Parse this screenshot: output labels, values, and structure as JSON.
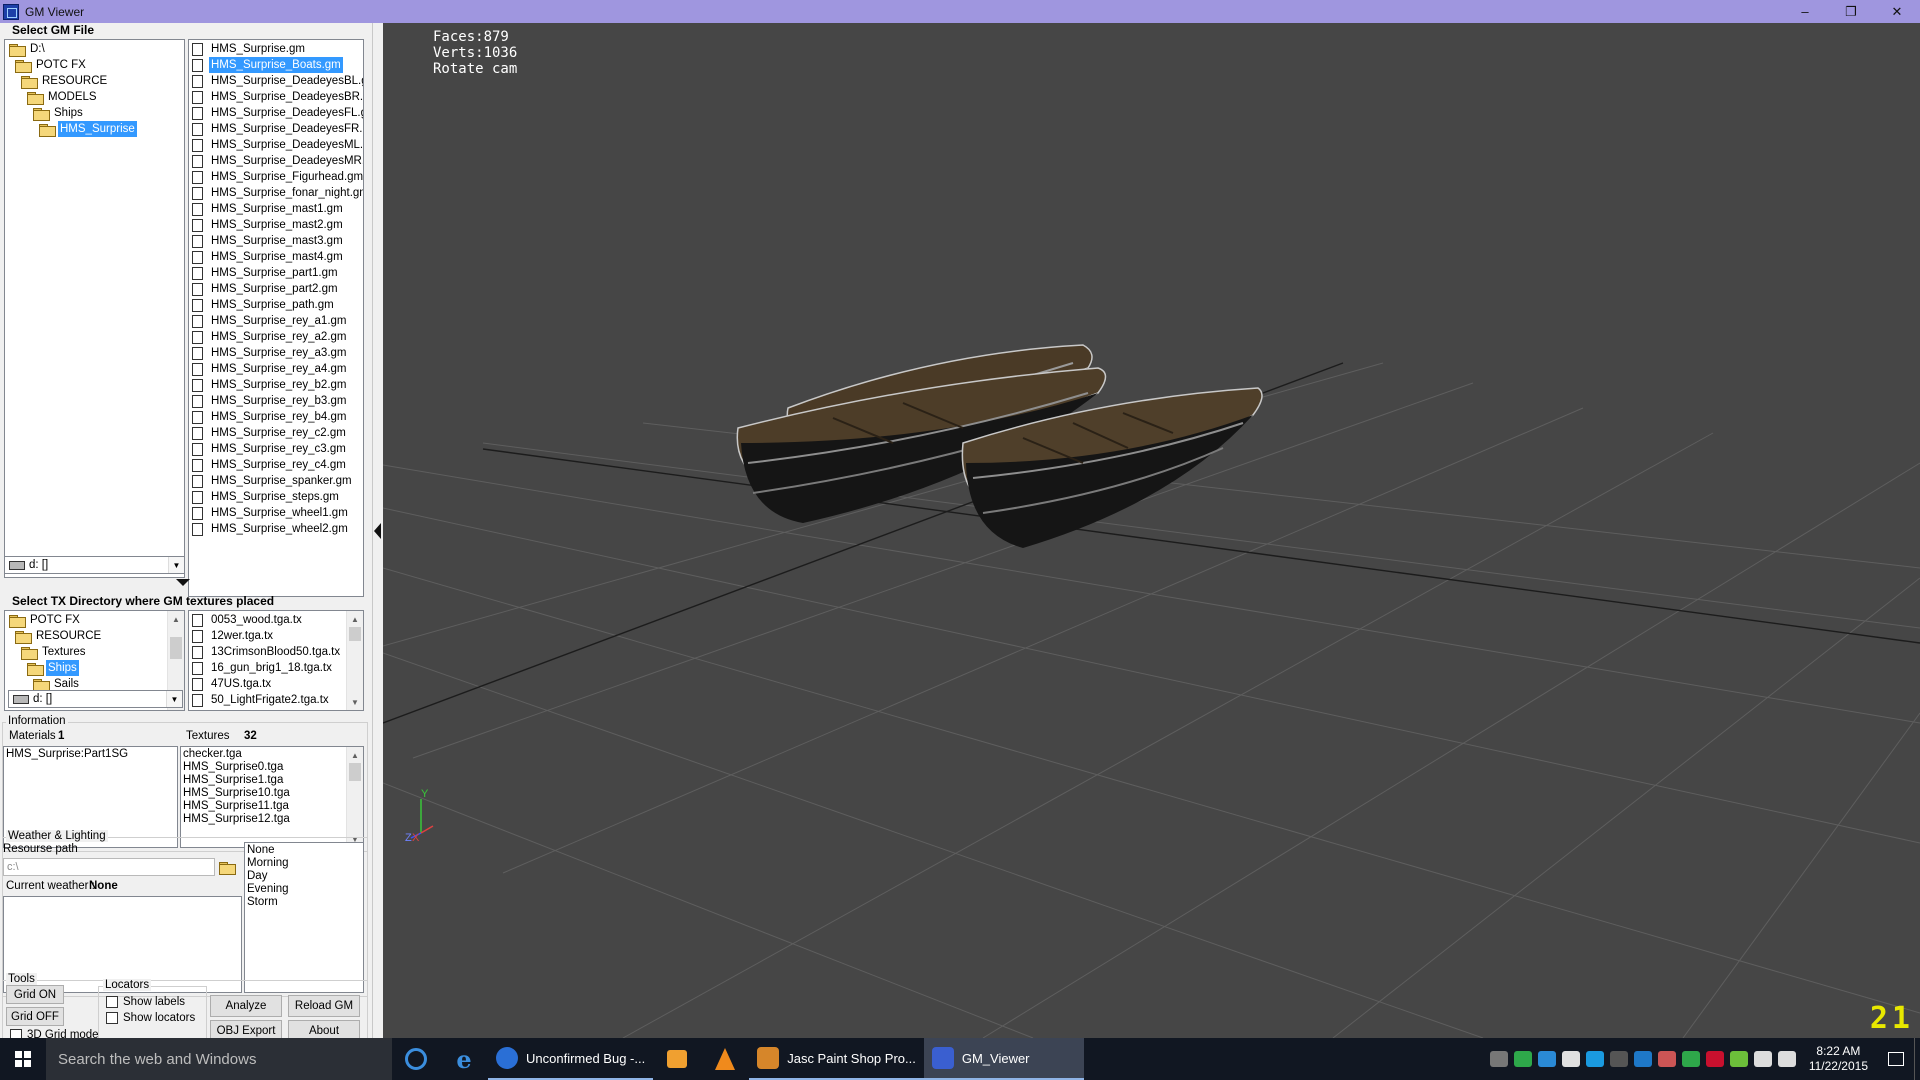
{
  "window": {
    "title": "GM Viewer",
    "minimize": "–",
    "maximize": "❐",
    "close": "✕"
  },
  "gm_section": {
    "title": "Select GM File",
    "tree": [
      {
        "label": "D:\\",
        "indent": 0
      },
      {
        "label": "POTC FX",
        "indent": 1
      },
      {
        "label": "RESOURCE",
        "indent": 2
      },
      {
        "label": "MODELS",
        "indent": 3
      },
      {
        "label": "Ships",
        "indent": 4
      },
      {
        "label": "HMS_Surprise",
        "indent": 5,
        "selected": true
      }
    ],
    "drive": "d: []",
    "files": [
      "HMS_Surprise.gm",
      "HMS_Surprise_Boats.gm",
      "HMS_Surprise_DeadeyesBL.gm",
      "HMS_Surprise_DeadeyesBR.gm",
      "HMS_Surprise_DeadeyesFL.gm",
      "HMS_Surprise_DeadeyesFR.gm",
      "HMS_Surprise_DeadeyesML.gm",
      "HMS_Surprise_DeadeyesMR.gm",
      "HMS_Surprise_Figurhead.gm",
      "HMS_Surprise_fonar_night.gm",
      "HMS_Surprise_mast1.gm",
      "HMS_Surprise_mast2.gm",
      "HMS_Surprise_mast3.gm",
      "HMS_Surprise_mast4.gm",
      "HMS_Surprise_part1.gm",
      "HMS_Surprise_part2.gm",
      "HMS_Surprise_path.gm",
      "HMS_Surprise_rey_a1.gm",
      "HMS_Surprise_rey_a2.gm",
      "HMS_Surprise_rey_a3.gm",
      "HMS_Surprise_rey_a4.gm",
      "HMS_Surprise_rey_b2.gm",
      "HMS_Surprise_rey_b3.gm",
      "HMS_Surprise_rey_b4.gm",
      "HMS_Surprise_rey_c2.gm",
      "HMS_Surprise_rey_c3.gm",
      "HMS_Surprise_rey_c4.gm",
      "HMS_Surprise_spanker.gm",
      "HMS_Surprise_steps.gm",
      "HMS_Surprise_wheel1.gm",
      "HMS_Surprise_wheel2.gm"
    ],
    "selected_file": 1
  },
  "tx_section": {
    "title": "Select TX Directory where GM textures placed",
    "tree": [
      {
        "label": "POTC FX",
        "indent": 0
      },
      {
        "label": "RESOURCE",
        "indent": 1
      },
      {
        "label": "Textures",
        "indent": 2
      },
      {
        "label": "Ships",
        "indent": 3,
        "selected": true
      },
      {
        "label": "Sails",
        "indent": 4
      }
    ],
    "drive": "d: []",
    "files": [
      "0053_wood.tga.tx",
      "12wer.tga.tx",
      "13CrimsonBlood50.tga.tx",
      "16_gun_brig1_18.tga.tx",
      "47US.tga.tx",
      "50_LightFrigate2.tga.tx"
    ]
  },
  "information": {
    "title": "Information",
    "materials_label": "Materials",
    "materials_count": "1",
    "textures_label": "Textures",
    "textures_count": "32",
    "materials": [
      "HMS_Surprise:Part1SG"
    ],
    "textures": [
      "checker.tga",
      "HMS_Surprise0.tga",
      "HMS_Surprise1.tga",
      "HMS_Surprise10.tga",
      "HMS_Surprise11.tga",
      "HMS_Surprise12.tga"
    ]
  },
  "weather": {
    "title": "Weather & Lighting",
    "resource_path_label": "Resourse path",
    "resource_path_placeholder": "c:\\",
    "current_label": "Current weather :",
    "current_value": "None",
    "options": [
      "None",
      "Morning",
      "Day",
      "Evening",
      "Storm"
    ]
  },
  "tools": {
    "title": "Tools",
    "grid_on": "Grid ON",
    "grid_off": "Grid OFF",
    "grid3d": "3D Grid mode",
    "locators_title": "Locators",
    "show_labels": "Show labels",
    "show_locators": "Show locators",
    "analyze": "Analyze",
    "reload": "Reload GM",
    "obj_export": "OBJ Export",
    "about": "About"
  },
  "viewport": {
    "faces": "Faces:879",
    "verts": "Verts:1036",
    "mode": "Rotate cam",
    "fps": "21",
    "axis_y": "Y",
    "axis_z": "Z",
    "axis_x": "X"
  },
  "taskbar": {
    "search_placeholder": "Search the web and Windows",
    "apps": [
      {
        "label": "Unconfirmed Bug -...",
        "color": "#2a6fd6"
      },
      {
        "label": "Jasc Paint Shop Pro...",
        "color": "#d6862a"
      },
      {
        "label": "GM_Viewer",
        "color": "#3a5fd0"
      }
    ],
    "time": "8:22 AM",
    "date": "11/22/2015"
  }
}
